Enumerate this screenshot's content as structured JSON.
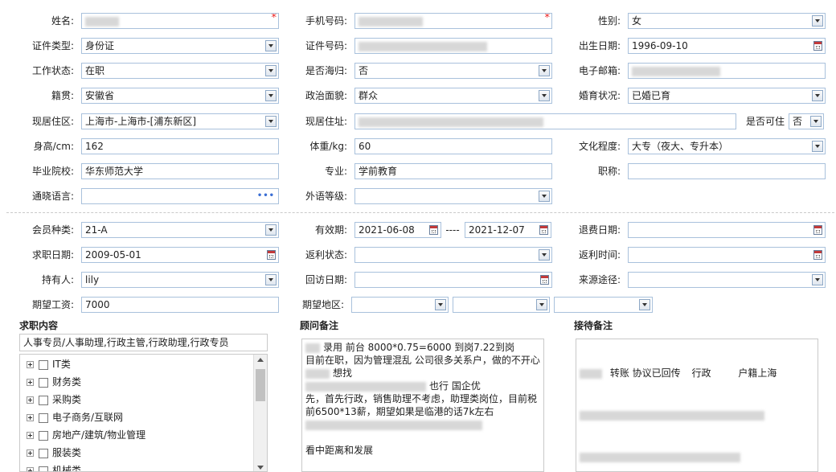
{
  "form": {
    "name": {
      "label": "姓名:",
      "value": ""
    },
    "phone": {
      "label": "手机号码:",
      "value": ""
    },
    "gender": {
      "label": "性别:",
      "value": "女"
    },
    "id_type": {
      "label": "证件类型:",
      "value": "身份证"
    },
    "id_number": {
      "label": "证件号码:",
      "value": ""
    },
    "birth_date": {
      "label": "出生日期:",
      "value": "1996-09-10"
    },
    "work_status": {
      "label": "工作状态:",
      "value": "在职"
    },
    "returnee": {
      "label": "是否海归:",
      "value": "否"
    },
    "email": {
      "label": "电子邮箱:",
      "value": ""
    },
    "native_place": {
      "label": "籍贯:",
      "value": "安徽省"
    },
    "political": {
      "label": "政治面貌:",
      "value": "群众"
    },
    "marital": {
      "label": "婚育状况:",
      "value": "已婚已育"
    },
    "residence_area": {
      "label": "现居住区:",
      "value": "上海市-上海市-[浦东新区]"
    },
    "address": {
      "label": "现居住址:",
      "value": ""
    },
    "can_live_in": {
      "label": "是否可住",
      "value": "否"
    },
    "height": {
      "label": "身高/cm:",
      "value": "162"
    },
    "weight": {
      "label": "体重/kg:",
      "value": "60"
    },
    "education": {
      "label": "文化程度:",
      "value": "大专（夜大、专升本）"
    },
    "school": {
      "label": "毕业院校:",
      "value": "华东师范大学"
    },
    "major": {
      "label": "专业:",
      "value": "学前教育"
    },
    "title": {
      "label": "职称:",
      "value": ""
    },
    "languages": {
      "label": "通晓语言:",
      "value": "",
      "more": "•••"
    },
    "foreign_level": {
      "label": "外语等级:",
      "value": ""
    },
    "member_type": {
      "label": "会员种类:",
      "value": "21-A"
    },
    "valid_period": {
      "label": "有效期:",
      "start": "2021-06-08",
      "sep": "----",
      "end": "2021-12-07"
    },
    "refund_date": {
      "label": "退费日期:",
      "value": ""
    },
    "apply_date": {
      "label": "求职日期:",
      "value": "2009-05-01"
    },
    "rebate_status": {
      "label": "返利状态:",
      "value": ""
    },
    "rebate_time": {
      "label": "返利时间:",
      "value": ""
    },
    "holder": {
      "label": "持有人:",
      "value": "lily"
    },
    "visit_date": {
      "label": "回访日期:",
      "value": ""
    },
    "source": {
      "label": "来源途径:",
      "value": ""
    },
    "salary": {
      "label": "期望工资:",
      "value": "7000"
    },
    "region": {
      "label": "期望地区:",
      "value": ""
    }
  },
  "job_panel": {
    "title": "求职内容",
    "selected": "人事专员/人事助理,行政主管,行政助理,行政专员",
    "categories": [
      "IT类",
      "财务类",
      "采购类",
      "电子商务/互联网",
      "房地产/建筑/物业管理",
      "服装类",
      "机械类"
    ]
  },
  "consult_panel": {
    "title": "顾问备注",
    "lines": [
      "录用  前台 8000*0.75=6000   到岗7.22到岗",
      "目前在职，因为管理混乱 公司很多关系户，做的不开心",
      "想找",
      "也行  国企优",
      "先，首先行政，销售助理不考虑，助理类岗位，目前税",
      "前6500*13薪，期望如果是临港的话7k左右",
      "",
      "",
      "看中距离和发展"
    ]
  },
  "reception_panel": {
    "title": "接待备注",
    "line1": [
      "转账  协议已回传",
      "行政",
      "户籍上海"
    ]
  }
}
